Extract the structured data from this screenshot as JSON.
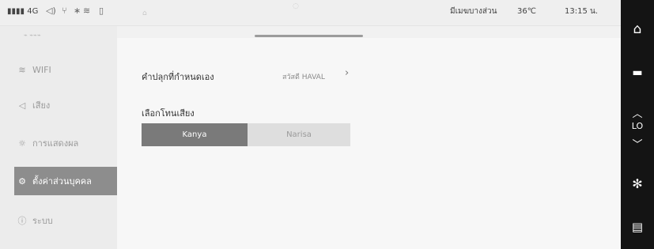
{
  "status_bar": {
    "signal": "4G",
    "cluster_label": "มีเมฆบางส่วน",
    "temperature": "36℃",
    "time": "13:15 น."
  },
  "sidebar": {
    "items": [
      {
        "label": "WIFI",
        "icon": "wifi-icon",
        "active": false
      },
      {
        "label": "เสียง",
        "icon": "sound-icon",
        "active": false
      },
      {
        "label": "การแสดงผล",
        "icon": "sun-icon",
        "active": false
      },
      {
        "label": "ตั้งค่าส่วนบุคคล",
        "icon": "gear-icon",
        "active": true
      },
      {
        "label": "ระบบ",
        "icon": "info-icon",
        "active": false
      }
    ]
  },
  "main": {
    "wake_word": {
      "label": "คำปลุกที่กำหนดเอง",
      "value": "สวัสดี HAVAL"
    },
    "voice": {
      "label": "เลือกโทนเสียง",
      "options": [
        "Kanya",
        "Narisa"
      ],
      "selected": "Kanya"
    }
  },
  "right_bar": {
    "temp_mode": "LO",
    "icons": [
      "home-icon",
      "car-seat-icon",
      "chevron-up-icon",
      "chevron-down-icon",
      "fan-icon",
      "phone-icon"
    ]
  }
}
